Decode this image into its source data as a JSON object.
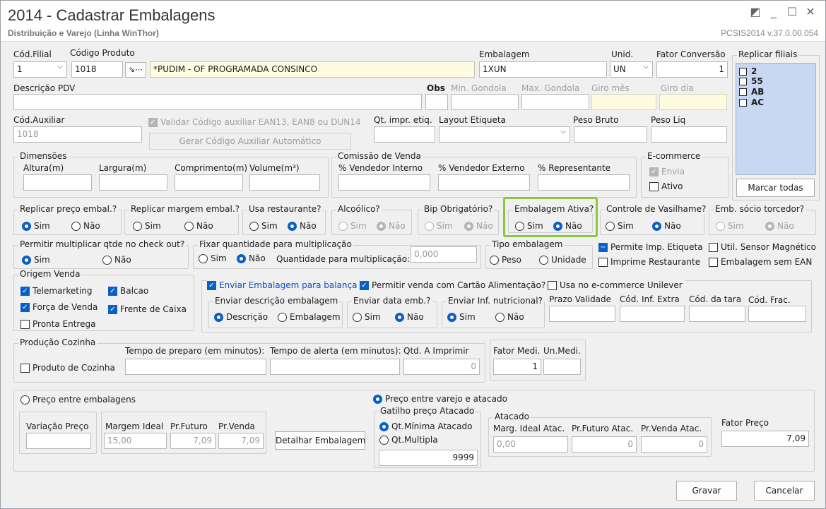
{
  "window": {
    "title": "2014 - Cadastrar Embalagens",
    "subtitle": "Distribuição e Varejo (Linha WinThor)",
    "version": "PCSIS2014  v.37.0.00.054"
  },
  "header": {
    "cod_filial_label": "Cód.Filial",
    "cod_filial_value": "1",
    "codigo_produto_label": "Código Produto",
    "codigo_produto_value": "1018",
    "produto_descricao": "*PUDIM - OF PROGRAMADA CONSINCO",
    "embalagem_label": "Embalagem",
    "embalagem_value": "1XUN",
    "unid_label": "Unid.",
    "unid_value": "UN",
    "fator_conversao_label": "Fator Conversão",
    "fator_conversao_value": "1",
    "replicar_filiais_label": "Replicar filiais",
    "filiais": [
      "2",
      "55",
      "AB",
      "AC"
    ],
    "marcar_todas": "Marcar todas"
  },
  "descricao": {
    "descricao_pdv_label": "Descrição PDV",
    "obs_label": "Obs",
    "min_gondola_label": "Min. Gondola",
    "max_gondola_label": "Max. Gondola",
    "giro_mes_label": "Giro mês",
    "giro_dia_label": "Giro dia"
  },
  "auxiliar": {
    "cod_auxiliar_label": "Cód.Auxiliar",
    "cod_auxiliar_value": "1018",
    "validar_label": "Validar Código auxiliar EAN13, EAN8 ou DUN14",
    "gerar_button": "Gerar Código Auxiliar Automático",
    "qt_impr_label": "Qt. impr. etiq.",
    "layout_label": "Layout Etiqueta",
    "peso_bruto_label": "Peso Bruto",
    "peso_liq_label": "Peso Liq"
  },
  "dimensoes": {
    "title": "Dimensões",
    "altura": "Altura(m)",
    "largura": "Largura(m)",
    "comprimento": "Comprimento(m)",
    "volume": "Volume(m³)"
  },
  "comissao": {
    "title": "Comissão de Venda",
    "interno": "% Vendedor Interno",
    "externo": "% Vendedor Externo",
    "representante": "% Representante"
  },
  "ecommerce": {
    "title": "E-commerce",
    "envia": "Envia",
    "ativo": "Ativo"
  },
  "radios": {
    "sim": "Sim",
    "nao": "Não",
    "peso": "Peso",
    "unidade": "Unidade",
    "descricao": "Descrição",
    "embalagem": "Embalagem"
  },
  "row1": {
    "replicar_preco": "Replicar preço embal.?",
    "replicar_margem": "Replicar margem embal.?",
    "usa_restaurante": "Usa restaurante?",
    "alcoolico": "Alcoólico?",
    "bip": "Bip Obrigatório?",
    "embalagem_ativa": "Embalagem Ativa?",
    "controle_vasilhame": "Controle de Vasilhame?",
    "emb_socio": "Emb. sócio torcedor?"
  },
  "row2": {
    "permitir_multiplicar": "Permitir multiplicar qtde no check out?",
    "fixar_quantidade": "Fixar quantidade para multiplicação",
    "quantidade_multiplicacao": "Quantidade para multiplicação:",
    "quantidade_value": "0,000",
    "tipo_embalagem": "Tipo embalagem",
    "permite_imp_etiqueta": "Permite Imp. Etiqueta",
    "util_sensor": "Util. Sensor Magnético",
    "imprime_restaurante": "Imprime Restaurante",
    "embalagem_sem_ean": "Embalagem sem EAN"
  },
  "origem": {
    "title": "Origem Venda",
    "telemarketing": "Telemarketing",
    "balcao": "Balcao",
    "forca_venda": "Força de Venda",
    "frente_caixa": "Frente de Caixa",
    "pronta_entrega": "Pronta Entrega"
  },
  "balanca": {
    "enviar_balanca": "Enviar Embalagem para balança",
    "cartao_alimentacao": "Permitir venda com Cartão Alimentação?",
    "ecommerce_unilever": "Usa no e-commerce Unilever",
    "enviar_descricao": "Enviar descrição embalagem",
    "enviar_data": "Enviar data emb.?",
    "enviar_inf": "Enviar Inf. nutricional?",
    "prazo_validade": "Prazo Validade",
    "cod_inf_extra": "Cód. Inf. Extra",
    "cod_tara": "Cód. da tara",
    "cod_frac": "Cód. Frac."
  },
  "producao": {
    "title": "Produção Cozinha",
    "produto_cozinha": "Produto de Cozinha",
    "tempo_preparo": "Tempo de preparo (em minutos):",
    "tempo_alerta": "Tempo de alerta (em minutos):",
    "qtd_imprimir": "Qtd. A Imprimir",
    "qtd_value": "0",
    "fator_medi": "Fator Medi.",
    "fator_medi_value": "1",
    "un_medi": "Un.Medi."
  },
  "preco": {
    "entre_embalagens": "Preço entre embalagens",
    "entre_varejo": "Preço entre varejo e atacado",
    "variacao": "Variação Preço",
    "margem_ideal": "Margem Ideal",
    "margem_ideal_value": "15,00",
    "pr_futuro": "Pr.Futuro",
    "pr_futuro_value": "7,09",
    "pr_venda": "Pr.Venda",
    "pr_venda_value": "7,09",
    "detalhar": "Detalhar Embalagem",
    "gatilho": "Gatilho preço Atacado",
    "qt_minima": "Qt.Mínima Atacado",
    "qt_multipla": "Qt.Multipla",
    "gatilho_value": "9999",
    "atacado": "Atacado",
    "marg_ideal_atac": "Marg. Ideal Atac.",
    "marg_ideal_atac_value": "0,00",
    "pr_futuro_atac": "Pr.Futuro Atac.",
    "pr_futuro_atac_value": "0",
    "pr_venda_atac": "Pr.Venda Atac.",
    "pr_venda_atac_value": "0",
    "fator_preco": "Fator Preço",
    "fator_preco_value": "7,09"
  },
  "footer": {
    "gravar": "Gravar",
    "cancelar": "Cancelar"
  }
}
